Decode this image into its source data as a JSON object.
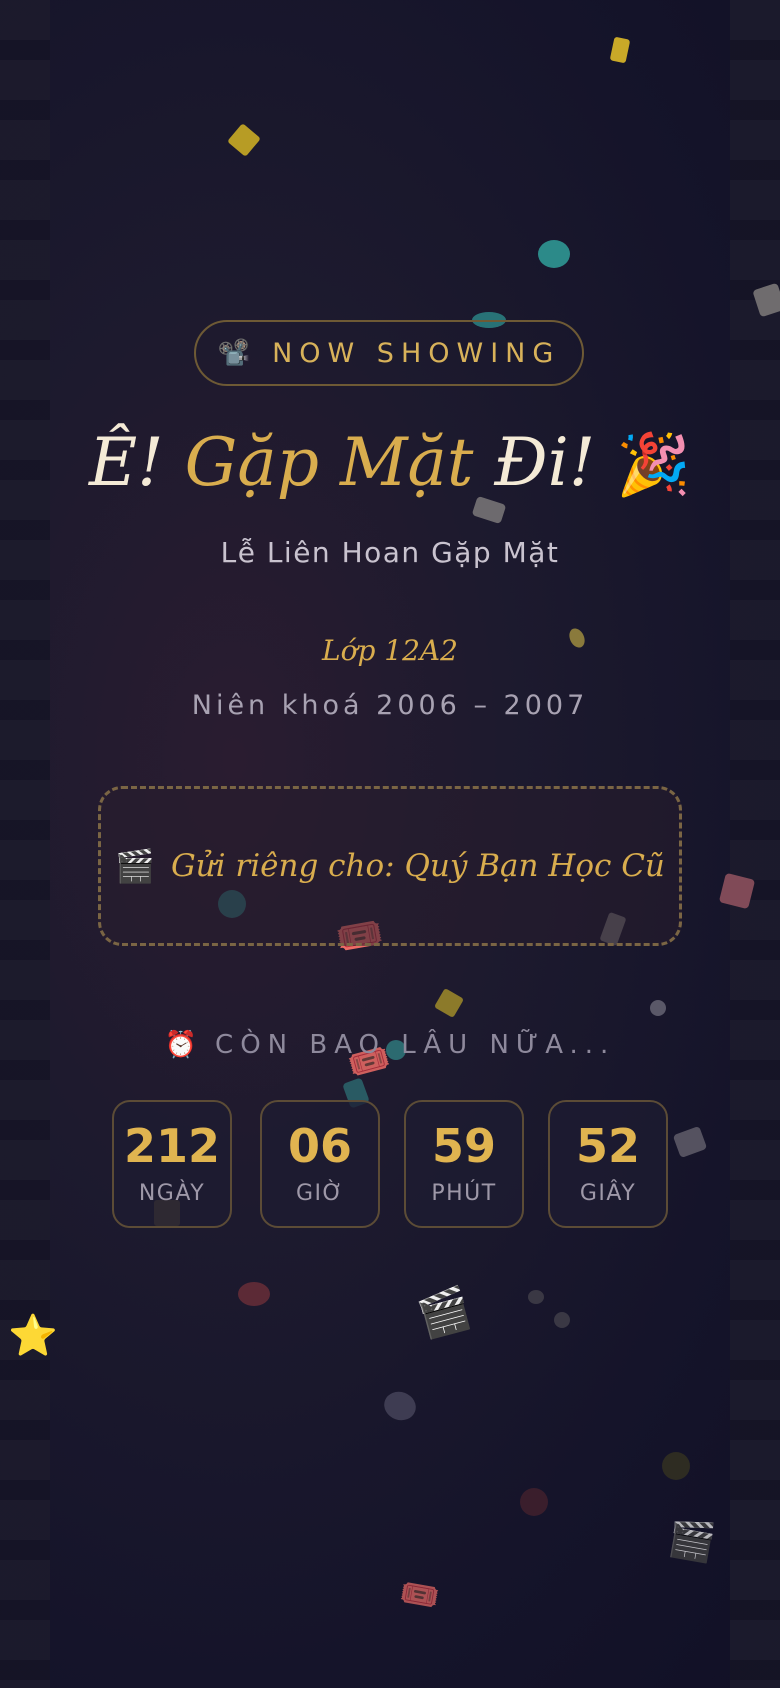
{
  "badge": {
    "icon": "📽️",
    "text": "NOW SHOWING"
  },
  "title": {
    "part1": "Ê! ",
    "part2": "Gặp Mặt",
    "part3": " Đi!",
    "emoji": "🎉"
  },
  "subtitle": "Lễ Liên Hoan Gặp Mặt",
  "class_name": "Lớp 12A2",
  "years": "Niên khoá 2006 – 2007",
  "invite": {
    "icon": "🎬",
    "text": "Gửi riêng cho: Quý Bạn Học Cũ"
  },
  "countdown": {
    "icon": "⏰",
    "label": "CÒN BAO LÂU NỮA...",
    "units": [
      {
        "value": "212",
        "label": "NGÀY"
      },
      {
        "value": "06",
        "label": "GIỜ"
      },
      {
        "value": "59",
        "label": "PHÚT"
      },
      {
        "value": "52",
        "label": "GIÂY"
      }
    ]
  },
  "decor": {
    "ticket_icon": "🎟️",
    "clapper_icon": "🎬",
    "star_icon": "⭐"
  },
  "colors": {
    "accent": "#d9ad4e",
    "background": "#15142a"
  }
}
